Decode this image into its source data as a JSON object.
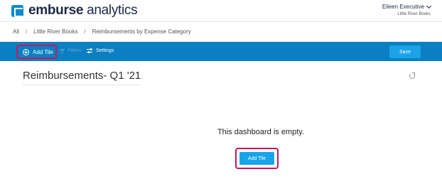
{
  "header": {
    "logo_word": "emburse",
    "logo_product": "analytics",
    "user_name": "Eileen Executive",
    "user_org": "Little River Books"
  },
  "breadcrumb": [
    "All",
    "Little River Books",
    "Reimbursements by Expense Category"
  ],
  "breadcrumb_separator": "/",
  "toolbar": {
    "add_tile_label": "Add Tile",
    "filters_label": "Filters",
    "settings_label": "Settings",
    "save_label": "Save"
  },
  "dashboard": {
    "title": "Reimbursements- Q1 '21",
    "empty_message": "This dashboard is empty.",
    "add_tile_label": "Add Tile"
  },
  "colors": {
    "toolbar_bg": "#0a7fc2",
    "button_bg": "#16a4ea",
    "highlight": "#c3185e",
    "brand_dark": "#1b2a47"
  }
}
